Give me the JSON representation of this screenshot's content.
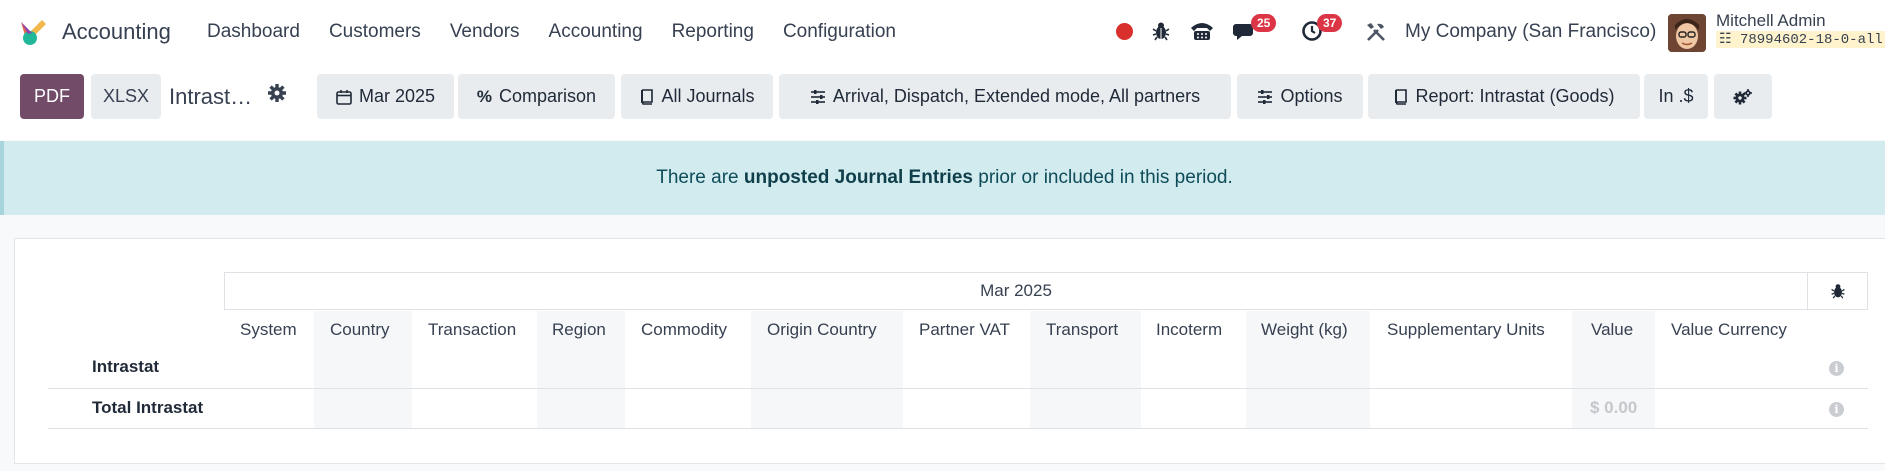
{
  "navbar": {
    "app_name": "Accounting",
    "menu": [
      "Dashboard",
      "Customers",
      "Vendors",
      "Accounting",
      "Reporting",
      "Configuration"
    ],
    "messages_count": "25",
    "activities_count": "37",
    "company": "My Company (San Francisco)",
    "user_name": "Mitchell Admin",
    "database": "78994602-18-0-all"
  },
  "controls": {
    "pdf_label": "PDF",
    "xlsx_label": "XLSX",
    "report_title": "Intrast…",
    "filters": [
      {
        "icon": "calendar-icon",
        "label": "Mar 2025"
      },
      {
        "icon": "percent-icon",
        "label": "Comparison"
      },
      {
        "icon": "book-icon",
        "label": "All Journals"
      },
      {
        "icon": "sliders-icon",
        "label": "Arrival, Dispatch, Extended mode, All partners"
      },
      {
        "icon": "sliders-icon",
        "label": "Options"
      },
      {
        "icon": "book-icon",
        "label": "Report: Intrastat (Goods)"
      },
      {
        "icon": "",
        "label": "In .$"
      }
    ]
  },
  "alert": {
    "prefix": "There are",
    "bold": "unposted Journal Entries",
    "suffix": "prior or included in this period."
  },
  "report": {
    "period": "Mar 2025",
    "columns": [
      "System",
      "Country",
      "Transaction",
      "Region",
      "Commodity",
      "Origin Country",
      "Partner VAT",
      "Transport",
      "Incoterm",
      "Weight (kg)",
      "Supplementary Units",
      "Value",
      "Value Currency"
    ],
    "rows": [
      {
        "label": "Intrastat",
        "value": ""
      },
      {
        "label": "Total Intrastat",
        "value": "$ 0.00"
      }
    ]
  },
  "colors": {
    "primary": "#714b67",
    "alert_bg": "#d1ebef",
    "badge": "#dc3545"
  }
}
